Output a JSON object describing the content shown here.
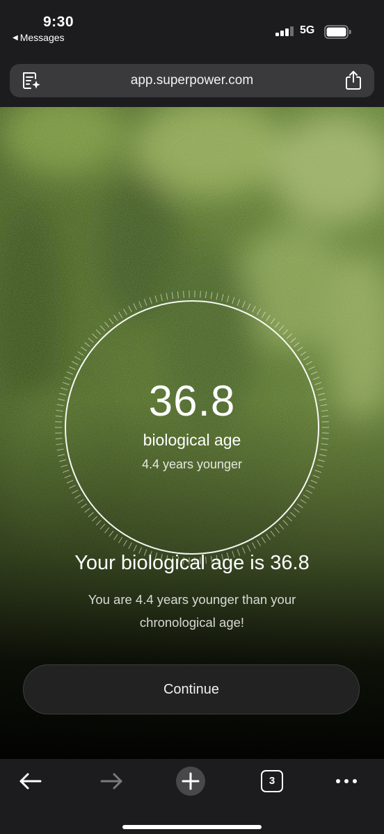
{
  "status_bar": {
    "time": "9:30",
    "back_app": "Messages",
    "network": "5G"
  },
  "browser": {
    "url": "app.superpower.com",
    "tab_count": "3"
  },
  "result": {
    "value": "36.8",
    "label": "biological age",
    "difference": "4.4 years younger",
    "title": "Your biological age is 36.8",
    "description": "You are 4.4 years younger than your chronological age!",
    "continue_label": "Continue"
  },
  "icons": {
    "reader": "reader-mode-icon",
    "share": "share-icon",
    "back": "back-arrow-icon",
    "forward": "forward-arrow-icon",
    "new_tab": "plus-icon",
    "tabs": "tabs-icon",
    "more": "more-icon"
  }
}
